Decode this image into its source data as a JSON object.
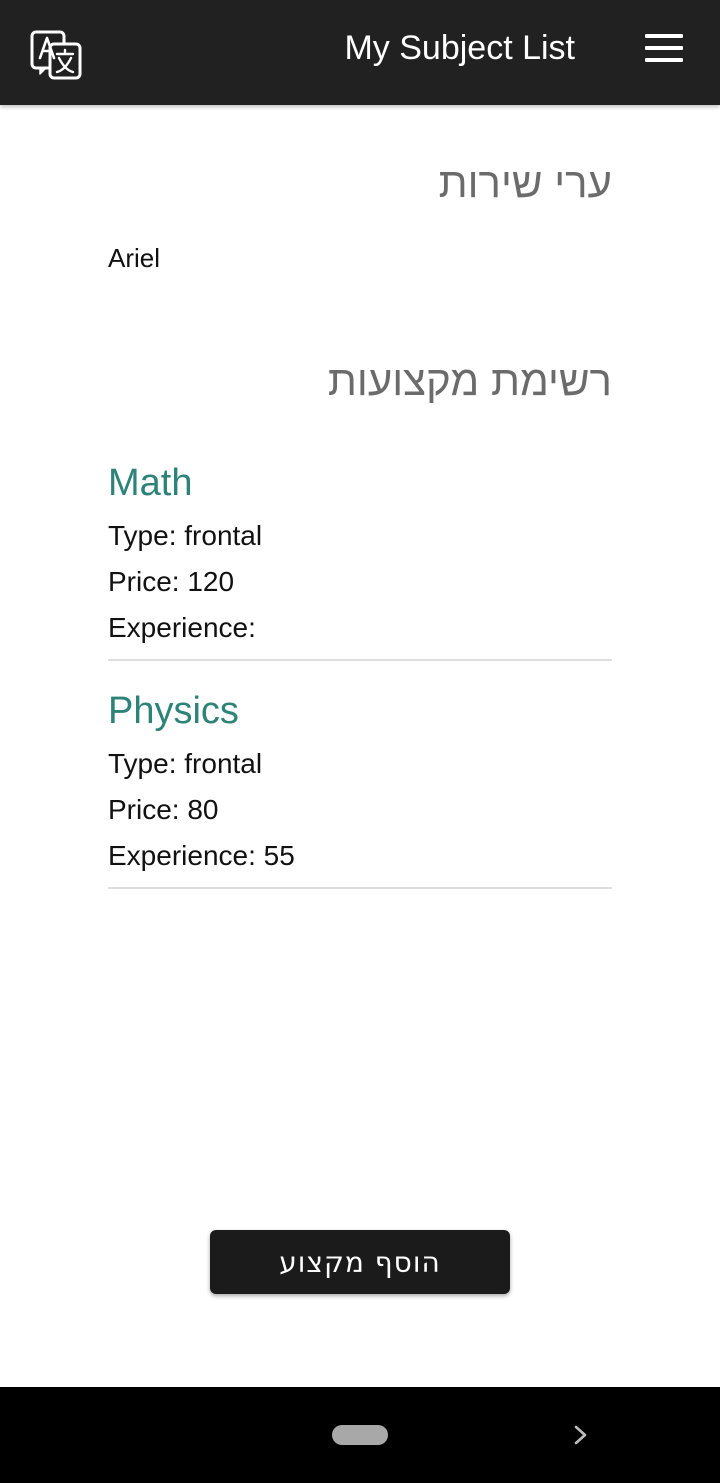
{
  "appbar": {
    "title": "My Subject List",
    "translate_icon": "translate-icon",
    "menu_icon": "hamburger-menu-icon"
  },
  "profile": {
    "city_heading": "ערי שירות",
    "name": "Ariel"
  },
  "subjects_heading": "רשימת מקצועות",
  "subjects": [
    {
      "name": "Math",
      "type_line": "Type: frontal",
      "price_line": "Price: 120",
      "experience_line": "Experience:"
    },
    {
      "name": "Physics",
      "type_line": "Type: frontal",
      "price_line": "Price: 80",
      "experience_line": "Experience: 55"
    }
  ],
  "add_button_label": "הוסף מקצוע",
  "navbar": {
    "home_icon": "home-pill-icon",
    "back_icon": "chevron-right-icon"
  },
  "colors": {
    "appbar": "#212121",
    "subject_title": "#2e8378",
    "heading": "#6b6b6b",
    "button": "#1b1b1b"
  }
}
